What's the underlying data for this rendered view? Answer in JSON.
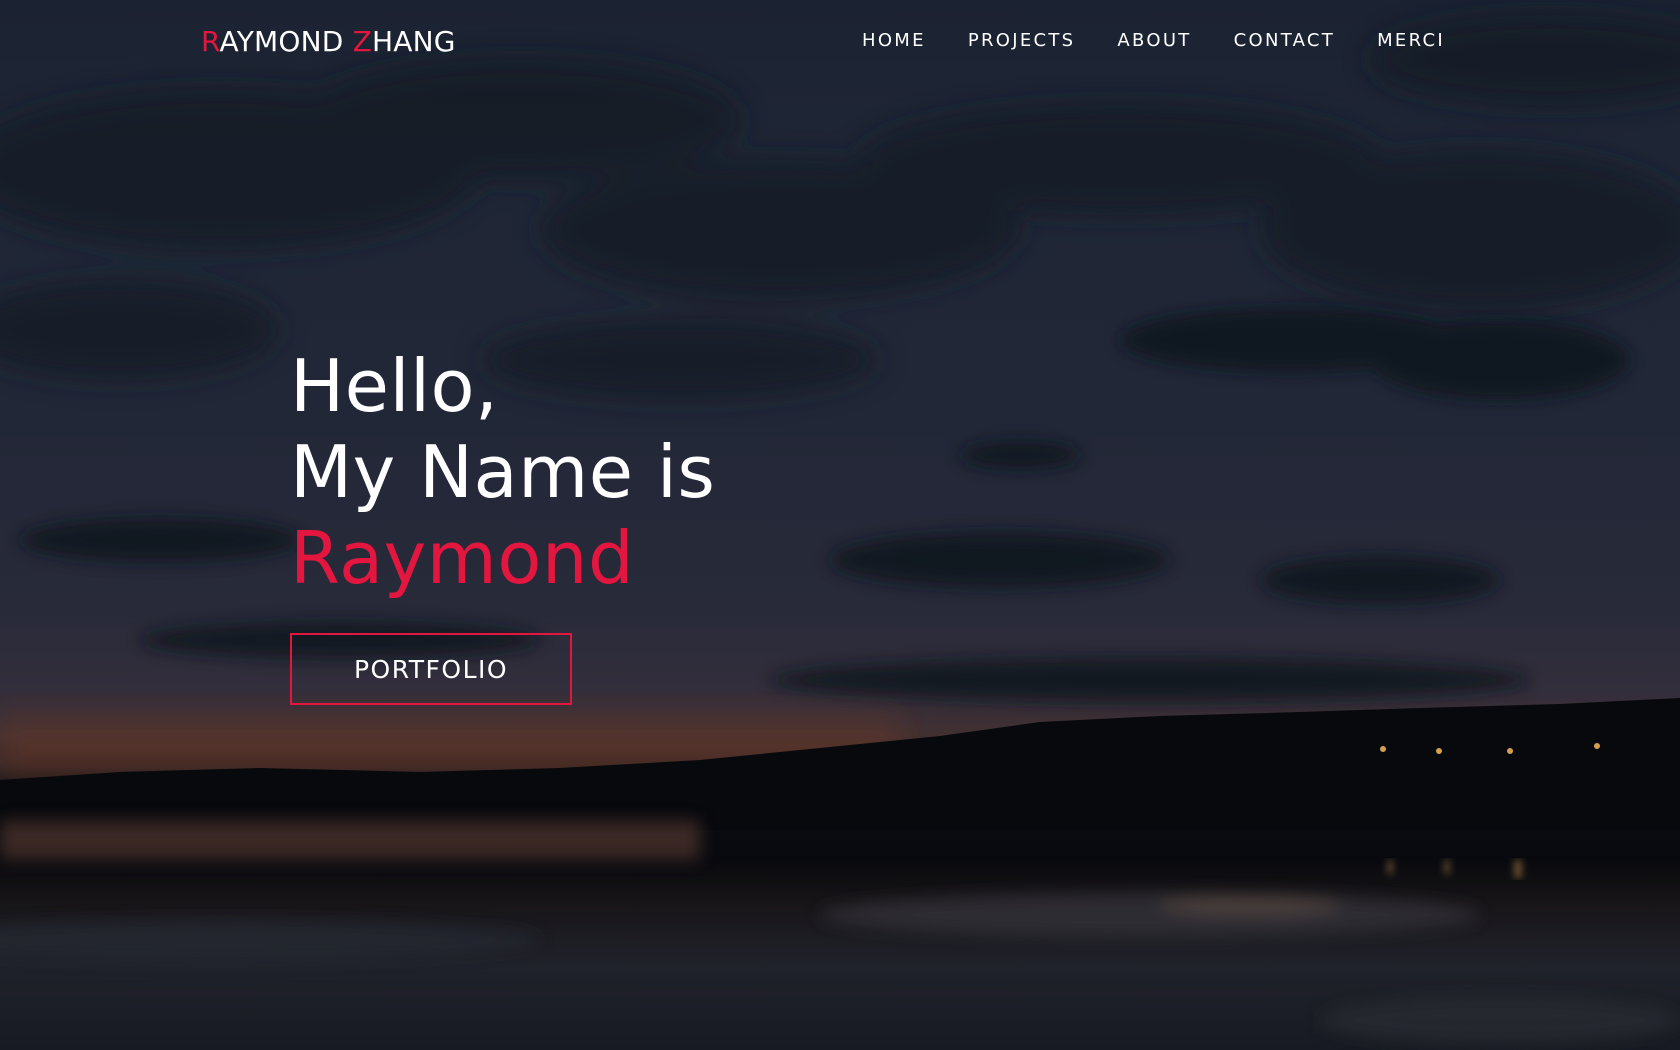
{
  "nav": {
    "logo": {
      "first_initial": "R",
      "first_rest": "AYMOND ",
      "last_initial": "Z",
      "last_rest": "HANG"
    },
    "links": [
      {
        "label": "HOME"
      },
      {
        "label": "PROJECTS"
      },
      {
        "label": "ABOUT"
      },
      {
        "label": "CONTACT"
      },
      {
        "label": "MERCI"
      }
    ]
  },
  "hero": {
    "line1": "Hello,",
    "line2": "My Name is",
    "name": "Raymond",
    "button_label": "PORTFOLIO"
  },
  "colors": {
    "accent": "#e2163f",
    "text": "#ffffff"
  }
}
